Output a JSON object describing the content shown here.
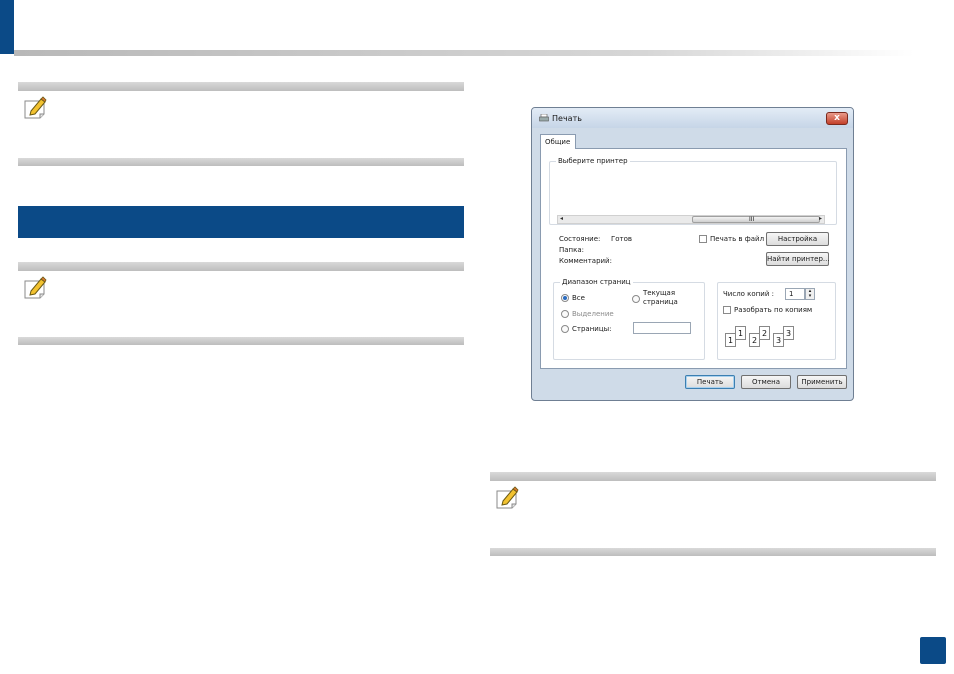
{
  "dialog": {
    "title": "Печать",
    "close_label": "x",
    "tab_general": "Общие",
    "select_printer_title": "Выберите принтер",
    "scroll_marker": "III",
    "status_label": "Состояние:",
    "status_value": "Готов",
    "folder_label": "Папка:",
    "comment_label": "Комментарий:",
    "print_to_file_label": "Печать в файл",
    "settings_button": "Настройка",
    "find_printer_button": "Найти принтер...",
    "page_range_title": "Диапазон страниц",
    "range_all": "Все",
    "range_current_line1": "Текущая",
    "range_current_line2": "страница",
    "range_selection": "Выделение",
    "range_pages": "Страницы:",
    "copies_label": "Число копий :",
    "copies_value": "1",
    "collate_label": "Разобрать по копиям",
    "collate_numbers": [
      "1",
      "1",
      "2",
      "2",
      "3",
      "3"
    ],
    "print_button": "Печать",
    "cancel_button": "Отмена",
    "apply_button": "Применить"
  },
  "colors": {
    "accent": "#0b4a87",
    "rule": "#bdbdbd"
  },
  "icons": {
    "note": "pencil-note-icon",
    "printer": "printer-icon"
  }
}
